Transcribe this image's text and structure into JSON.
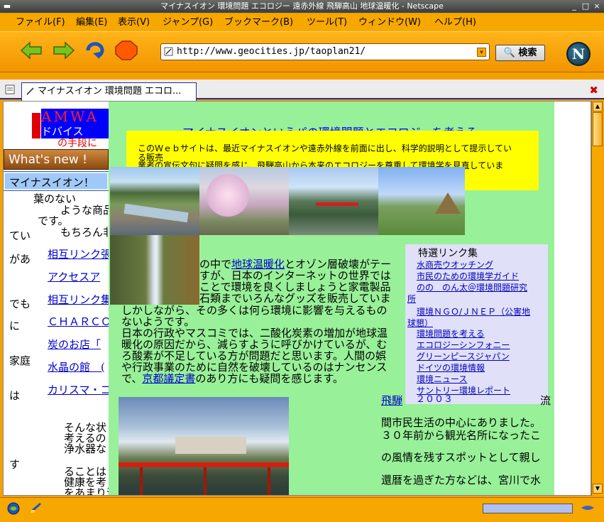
{
  "window": {
    "title": "マイナスイオン 環境問題 エコロジー 遠赤外線 飛騨高山 地球温暖化 - Netscape"
  },
  "menu": [
    "ファイル(F)",
    "編集(E)",
    "表示(V)",
    "ジャンプ(G)",
    "ブックマーク(B)",
    "ツール(T)",
    "ウィンドウ(W)",
    "ヘルプ(H)"
  ],
  "toolbar": {
    "url": "http://www.geocities.jp/taoplan21/",
    "search_label": "検索"
  },
  "tab": {
    "title": "マイナスイオン 環境問題 エコロ..."
  },
  "page": {
    "amway_text": "AMWA",
    "advice_text": "ドバイス",
    "side_text_1": "の手段に",
    "whats_new": "What's new !",
    "minus_ion_button": "マイナスイオン！",
    "header_text": "マイナスイオンというパの環境問題とエコロジーを考える",
    "intro_text_line1": "このＷｅｂサイトは、最近マイナスイオンや遠赤外線を前面に出し、科学的説明として提示してい",
    "intro_text_line2": "る販売",
    "intro_text_line3": "業者の宣伝文句に疑問を感じ、飛騨高山から本来のエコロジーを尊重して環境学を見直していま",
    "left_col": [
      "葉のない",
      "ような商品",
      "です。",
      "もちろん非",
      "てい",
      "があ",
      "でも",
      "に",
      "家庭",
      "は",
      "す"
    ],
    "left_links": [
      "相互リンク張",
      "アクセスア",
      "相互リンク集",
      "ＣＨＡＲＣＯ",
      "炭のお店「",
      "水晶の館　(",
      "カリスマ・コ"
    ],
    "left_lower": [
      "そんな状",
      "考えるの",
      "浄水器な",
      "ることは",
      "健康を考",
      "をあまり浴"
    ],
    "main_paragraph": [
      "の中で",
      "地球温暖化",
      "とオゾン層破壊がテー",
      "すが、日本のインターネットの世界では",
      "ことで環境を良くしましょうと家電製品",
      "石類までいろんなグッズを販売していま",
      "しかしながら、その多くは何ら環境に影響を与えるもの",
      "ないようです。",
      "日本の行政やマスコミでは、二酸化炭素の増加が地球温",
      "暖化の原因だから、減らすように呼びかけているが、む",
      "ろ酸素が不足している方が問題だと思います。人間の娯",
      "や行政事業のために自然を破壊しているのはナンセンス",
      "で、",
      "京都議定書",
      "のあり方にも疑問を感じます。"
    ],
    "links_box": {
      "title": "特選リンク集",
      "items": [
        "水商売ウオッチング",
        "市民のための環境学ガイド",
        "のの　のん太＠環境問題研究",
        "所",
        "環境ＮＧＯ/ＪＮＥＰ（公害地",
        "球懇）",
        "環境問題を考える",
        "エコロジーシンフォニー",
        "グリーンピースジャパン",
        "ドイツの環境情報",
        "環境ニュース",
        "サントリー環境レポート"
      ]
    },
    "right_text": {
      "hida_link": "飛騨",
      "year": "２００３",
      "lines": [
        "間市民生活の中心にありました。",
        "３０年前から観光名所になったこ",
        "の風情を残すスポットとして親し",
        "還暦を過ぎた方などは、宮川で水"
      ],
      "tail": "流"
    }
  },
  "colors": {
    "chrome_orange": "#f7a800",
    "page_green": "#98f098",
    "intro_yellow": "#ffff00",
    "link_blue": "#0000cc",
    "links_box_bg": "#e0e0f8"
  }
}
